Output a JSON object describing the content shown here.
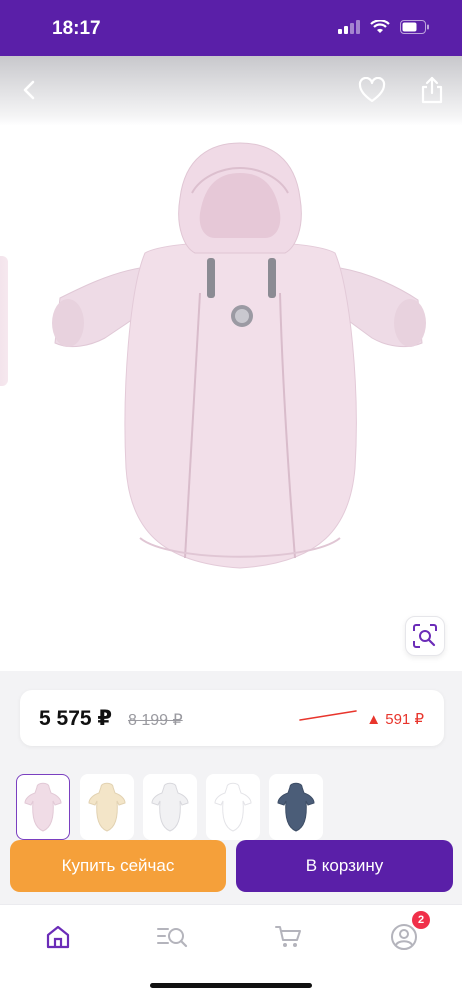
{
  "status_bar": {
    "time": "18:17"
  },
  "product": {
    "price_current": "5 575 ₽",
    "price_old": "8 199 ₽",
    "price_drop": "▲ 591 ₽",
    "thumbnail_colors": [
      "#f0dce6",
      "#f3e5c8",
      "#f1f1f3",
      "#ffffff",
      "#4b5d78"
    ],
    "main_color": "#f2dfe9"
  },
  "actions": {
    "buy_now_label": "Купить сейчас",
    "add_to_cart_label": "В корзину"
  },
  "tab_bar": {
    "profile_badge": "2"
  },
  "colors": {
    "brand": "#5a1fa8",
    "buy_button": "#f5a03a",
    "price_drop": "#e8352c",
    "badge": "#f0304a"
  },
  "icons": [
    "back-icon",
    "heart-icon",
    "share-icon",
    "visual-search-icon",
    "home-icon",
    "catalog-search-icon",
    "cart-icon",
    "profile-icon"
  ]
}
